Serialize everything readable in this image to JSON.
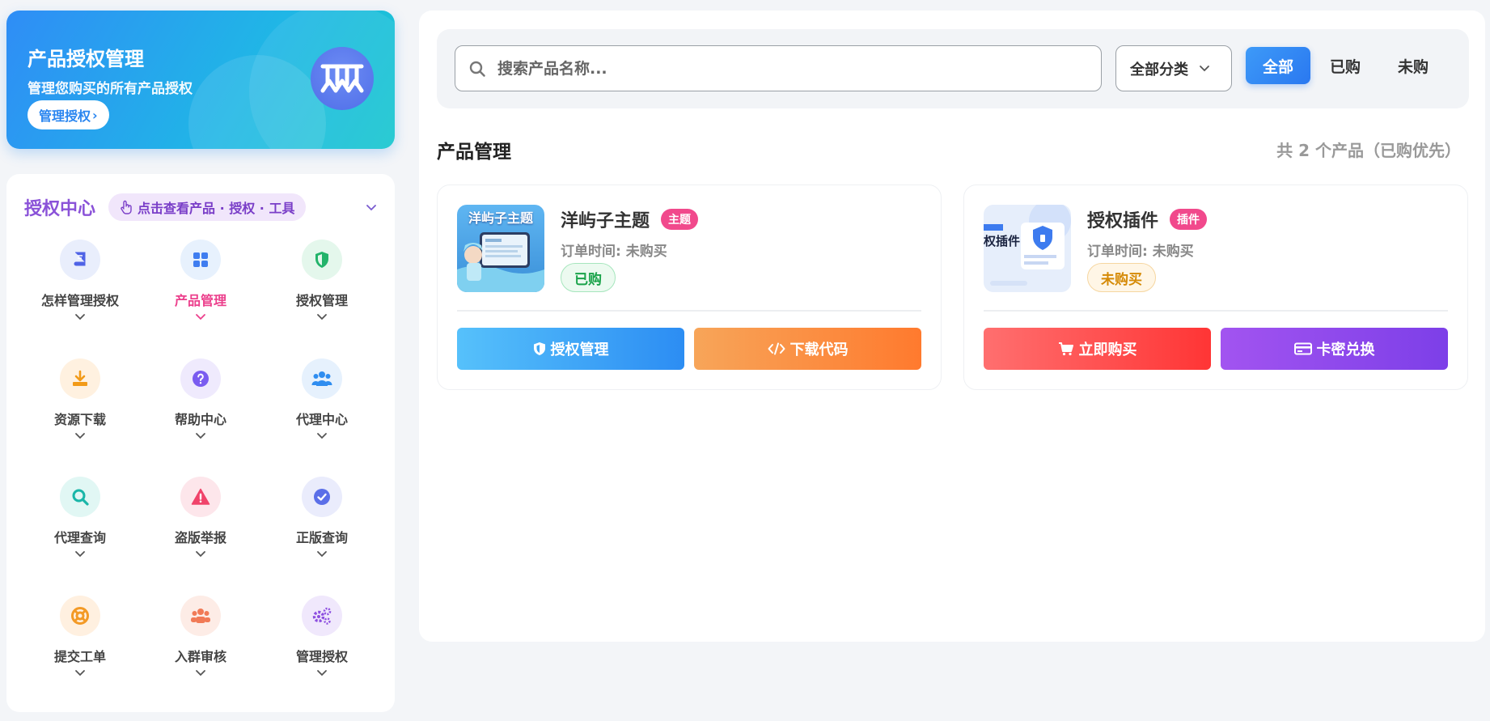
{
  "hero": {
    "title": "产品授权管理",
    "subtitle": "管理您购买的所有产品授权",
    "button_label": "管理授权",
    "button_arrow": "›"
  },
  "center": {
    "title": "授权中心",
    "hint": "点击查看产品 · 授权 · 工具",
    "items": [
      {
        "label": "怎样管理授权",
        "icon": "book-icon",
        "color": "#4f63e6",
        "bg": "#e9eefc"
      },
      {
        "label": "产品管理",
        "icon": "grid-icon",
        "color": "#3f7df0",
        "bg": "#e7f1fd",
        "active": true
      },
      {
        "label": "授权管理",
        "icon": "shield-icon",
        "color": "#22b36a",
        "bg": "#e4f7ec"
      },
      {
        "label": "资源下载",
        "icon": "download-icon",
        "color": "#f29a18",
        "bg": "#fff1e0"
      },
      {
        "label": "帮助中心",
        "icon": "question-icon",
        "color": "#7a5cf0",
        "bg": "#efeafd"
      },
      {
        "label": "代理中心",
        "icon": "users-icon",
        "color": "#2f8df0",
        "bg": "#e6f1fd"
      },
      {
        "label": "代理查询",
        "icon": "search-icon",
        "color": "#19b6a8",
        "bg": "#e1f7f4"
      },
      {
        "label": "盗版举报",
        "icon": "warning-icon",
        "color": "#f0436a",
        "bg": "#fde6eb"
      },
      {
        "label": "正版查询",
        "icon": "check-circle-icon",
        "color": "#5b6fe8",
        "bg": "#eaecfc"
      },
      {
        "label": "提交工单",
        "icon": "lifebuoy-icon",
        "color": "#f39a26",
        "bg": "#fff0e0"
      },
      {
        "label": "入群审核",
        "icon": "group-icon",
        "color": "#f17a56",
        "bg": "#fdece6"
      },
      {
        "label": "管理授权",
        "icon": "gears-icon",
        "color": "#8d4fe0",
        "bg": "#f0e8fc"
      }
    ]
  },
  "search": {
    "placeholder": "搜索产品名称...",
    "category": "全部分类",
    "tabs": [
      "全部",
      "已购",
      "未购"
    ]
  },
  "section": {
    "title": "产品管理",
    "count": "共 2 个产品（已购优先）"
  },
  "products": [
    {
      "name": "洋屿子主题",
      "tag": "主题",
      "time": "订单时间: 未购买",
      "status": "已购",
      "thumb_text": "洋屿子主题",
      "btn1": "授权管理",
      "btn2": "下载代码"
    },
    {
      "name": "授权插件",
      "tag": "插件",
      "time": "订单时间: 未购买",
      "status": "未购买",
      "thumb_text": "权插件",
      "btn1": "立即购买",
      "btn2": "卡密兑换"
    }
  ]
}
